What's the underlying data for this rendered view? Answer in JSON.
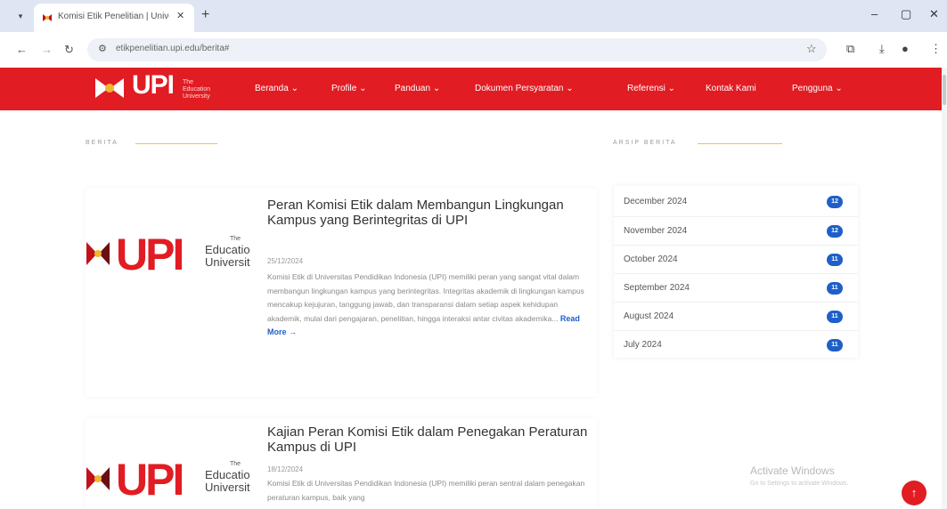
{
  "browser": {
    "tab_title": "Komisi Etik Penelitian | Univers",
    "tab_dropdown": "▾",
    "tab_close": "✕",
    "new_tab": "+",
    "url": "etikpenelitian.upi.edu/berita#",
    "window": {
      "minimize": "–",
      "maximize": "▢",
      "close": "✕"
    }
  },
  "site": {
    "logo_text": "UPI",
    "logo_sub": [
      "The",
      "Education",
      "University"
    ],
    "nav": [
      {
        "label": "Beranda ⌄"
      },
      {
        "label": "Profile ⌄"
      },
      {
        "label": "Panduan ⌄"
      },
      {
        "label": "Dokumen Persyaratan ⌄"
      },
      {
        "label": "Referensi ⌄"
      },
      {
        "label": "Kontak Kami"
      },
      {
        "label": "Pengguna ⌄"
      }
    ],
    "brand_color": "#e11c23",
    "accent_color": "#1e5fc8"
  },
  "berita": {
    "heading": "BERITA",
    "thumb": {
      "u": "UPI",
      "the": "The",
      "line1": "Educatio",
      "line2": "Universit"
    },
    "articles": [
      {
        "title": "Peran Komisi Etik dalam Membangun Lingkungan Kampus yang Berintegritas di UPI",
        "date": "25/12/2024",
        "excerpt": "Komisi Etik di Universitas Pendidikan Indonesia (UPI) memiliki peran yang sangat vital dalam membangun lingkungan kampus yang berintegritas. Integritas akademik di lingkungan kampus mencakup kejujuran, tanggung jawab, dan transparansi dalam setiap aspek kehidupan akademik, mulai dari pengajaran, penelitian, hingga interaksi antar civitas akademika...",
        "read_more": "Read More →"
      },
      {
        "title": "Kajian Peran Komisi Etik dalam Penegakan Peraturan Kampus di UPI",
        "date": "18/12/2024",
        "excerpt": "Komisi Etik di Universitas Pendidikan Indonesia (UPI) memiliki peran sentral dalam penegakan peraturan kampus, baik yang",
        "read_more": ""
      }
    ]
  },
  "arsip": {
    "heading": "ARSIP BERITA",
    "items": [
      {
        "label": "December 2024",
        "count": "12"
      },
      {
        "label": "November 2024",
        "count": "12"
      },
      {
        "label": "October 2024",
        "count": "11"
      },
      {
        "label": "September 2024",
        "count": "11"
      },
      {
        "label": "August 2024",
        "count": "11"
      },
      {
        "label": "July 2024",
        "count": "11"
      }
    ]
  },
  "watermark": {
    "line1": "Activate Windows",
    "line2": "Go to Settings to activate Windows."
  },
  "back_to_top": "↑"
}
